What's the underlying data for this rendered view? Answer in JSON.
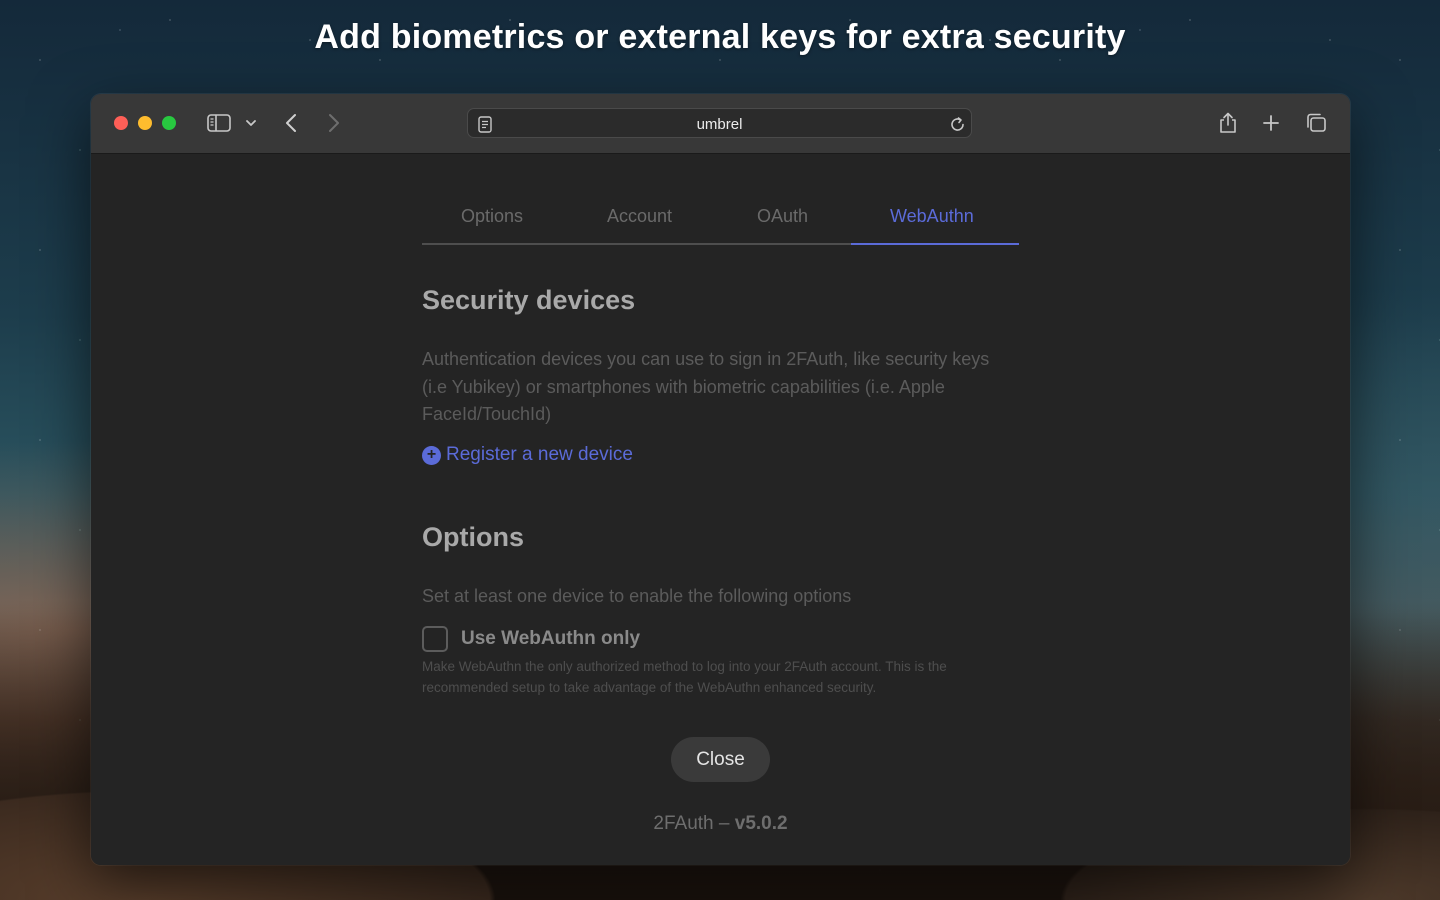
{
  "headline": "Add biometrics or external keys for extra security",
  "browser": {
    "address": "umbrel",
    "icons": {
      "sidebar": "sidebar-icon",
      "chevron": "chevron-down-icon",
      "back": "back-icon",
      "forward": "forward-icon",
      "reader": "reader-icon",
      "reload": "reload-icon",
      "share": "share-icon",
      "new_tab": "plus-icon",
      "tabs": "tab-overview-icon"
    }
  },
  "tabs": [
    {
      "label": "Options",
      "active": false
    },
    {
      "label": "Account",
      "active": false
    },
    {
      "label": "OAuth",
      "active": false
    },
    {
      "label": "WebAuthn",
      "active": true
    }
  ],
  "security": {
    "title": "Security devices",
    "description": "Authentication devices you can use to sign in 2FAuth, like security keys (i.e Yubikey) or smartphones with biometric capabilities (i.e. Apple FaceId/TouchId)",
    "register_link": "Register a new device"
  },
  "options": {
    "title": "Options",
    "description": "Set at least one device to enable the following options",
    "checkbox_label": "Use WebAuthn only",
    "checkbox_checked": false,
    "help_text": "Make WebAuthn the only authorized method to log into your 2FAuth account. This is the recommended setup to take advantage of the WebAuthn enhanced security."
  },
  "close_label": "Close",
  "footer": {
    "app": "2FAuth",
    "separator": " – ",
    "version": "v5.0.2"
  },
  "colors": {
    "accent": "#5b6bd8",
    "window_bg": "#242424",
    "toolbar_bg": "#383838"
  }
}
